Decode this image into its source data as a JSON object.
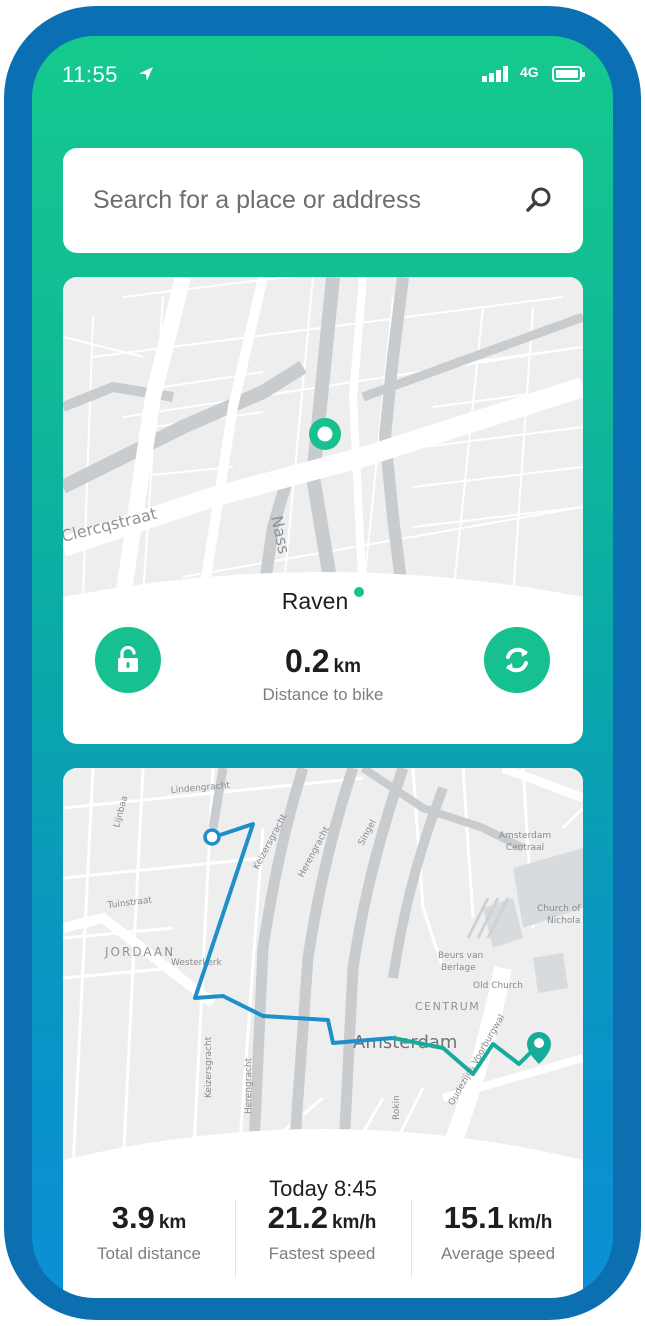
{
  "status_bar": {
    "time": "11:55",
    "network": "4G"
  },
  "search": {
    "placeholder": "Search for a place or address"
  },
  "bike_card": {
    "map_labels": {
      "street_1": "Clercqstraat",
      "street_2": "Nass"
    },
    "bike_name": "Raven",
    "distance_value": "0.2",
    "distance_unit": "km",
    "distance_label": "Distance to bike"
  },
  "ride_card": {
    "map_labels": {
      "lindengracht": "Lindengracht",
      "lijnbaans": "Lijnbaa",
      "tuinstraat": "Tuinstraat",
      "jordaan": "JORDAAN",
      "westerkerk": "Westerkerk",
      "keizersgracht_top": "Keizersgracht",
      "herengracht_top": "Herengracht",
      "singel": "Singel",
      "amsterdam_centraal_1": "Amsterdam",
      "amsterdam_centraal_2": "Centraal",
      "church_1": "Church of",
      "church_2": "Nichola",
      "beurs_1": "Beurs van",
      "beurs_2": "Berlage",
      "old_church": "Old Church",
      "centrum": "CENTRUM",
      "amsterdam": "Amsterdam",
      "oz_voorburgwal": "Oudezijds Voorburgwal",
      "rokin": "Rokin",
      "keizersgracht_bottom": "Keizersgracht",
      "herengracht_bottom": "Herengracht"
    },
    "ride_time": "Today 8:45",
    "stats": [
      {
        "value": "3.9",
        "unit": "km",
        "label": "Total distance"
      },
      {
        "value": "21.2",
        "unit": "km/h",
        "label": "Fastest speed"
      },
      {
        "value": "15.1",
        "unit": "km/h",
        "label": "Average speed"
      }
    ]
  },
  "colors": {
    "accent_green": "#16c08f",
    "route_blue": "#1e8fc9",
    "route_teal": "#16ab9a",
    "frame_blue": "#0b6fb4"
  },
  "icons": [
    "location-arrow-icon",
    "signal-icon",
    "battery-icon",
    "search-icon",
    "unlock-icon",
    "refresh-icon",
    "bike-location-marker-icon",
    "route-start-icon",
    "route-end-pin-icon"
  ]
}
